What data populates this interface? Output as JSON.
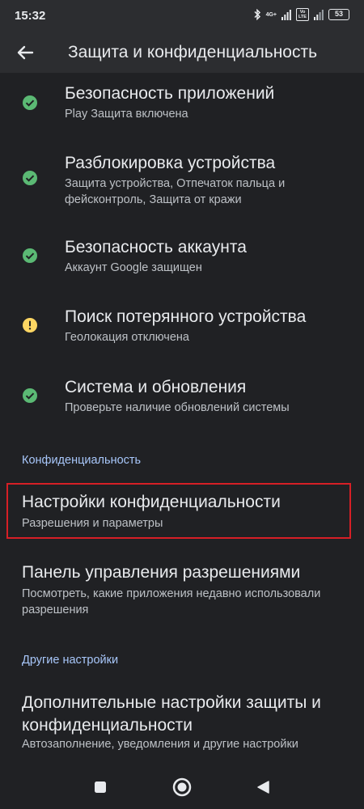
{
  "status_bar": {
    "time": "15:32",
    "network_label": "4G+",
    "volte_label": "Vo LTE",
    "battery": "53",
    "icons": [
      "bluetooth-icon",
      "signal-icon",
      "signal-icon",
      "battery-icon"
    ]
  },
  "app_bar": {
    "title": "Защита и конфиденциальность",
    "back_icon": "arrow-left-icon"
  },
  "security_items": [
    {
      "title": "Безопасность приложений",
      "subtitle": "Play Защита включена",
      "status": "ok",
      "icon": "check-circle-icon"
    },
    {
      "title": "Разблокировка устройства",
      "subtitle": "Защита устройства, Отпечаток пальца и фейсконтроль, Защита от кражи",
      "status": "ok",
      "icon": "check-circle-icon"
    },
    {
      "title": "Безопасность аккаунта",
      "subtitle": "Аккаунт Google защищен",
      "status": "ok",
      "icon": "check-circle-icon"
    },
    {
      "title": "Поиск потерянного устройства",
      "subtitle": "Геолокация отключена",
      "status": "warning",
      "icon": "warning-circle-icon"
    },
    {
      "title": "Система и обновления",
      "subtitle": "Проверьте наличие обновлений системы",
      "status": "ok",
      "icon": "check-circle-icon"
    }
  ],
  "privacy_section": {
    "header": "Конфиденциальность",
    "items": [
      {
        "title": "Настройки конфиденциальности",
        "subtitle": "Разрешения и параметры",
        "highlighted": true
      },
      {
        "title": "Панель управления разрешениями",
        "subtitle": "Посмотреть, какие приложения недавно использовали разрешения"
      }
    ]
  },
  "other_section": {
    "header": "Другие настройки",
    "items": [
      {
        "title": "Дополнительные настройки защиты и конфиденциальности",
        "subtitle": "Автозаполнение, уведомления и другие настройки"
      }
    ]
  },
  "nav_bar": {
    "buttons": [
      "recents-square-icon",
      "home-circle-icon",
      "back-triangle-icon"
    ]
  },
  "colors": {
    "background": "#202124",
    "ok_green": "#5bb974",
    "warning_yellow": "#fdd663",
    "section_header": "#a8c7fa",
    "highlight_border": "#d61f26"
  }
}
